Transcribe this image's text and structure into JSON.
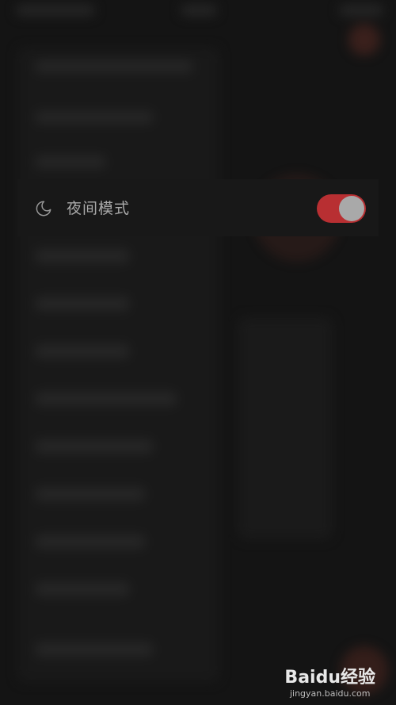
{
  "settings": {
    "night_mode": {
      "icon": "moon-icon",
      "label": "夜间模式",
      "enabled": true
    }
  },
  "colors": {
    "background": "#141414",
    "toggle_on": "#b82f32",
    "toggle_knob": "#a9a9a9",
    "label_text": "#aaaaaa"
  },
  "watermark": {
    "logo_text": "Baidu经验",
    "url": "jingyan.baidu.com"
  }
}
